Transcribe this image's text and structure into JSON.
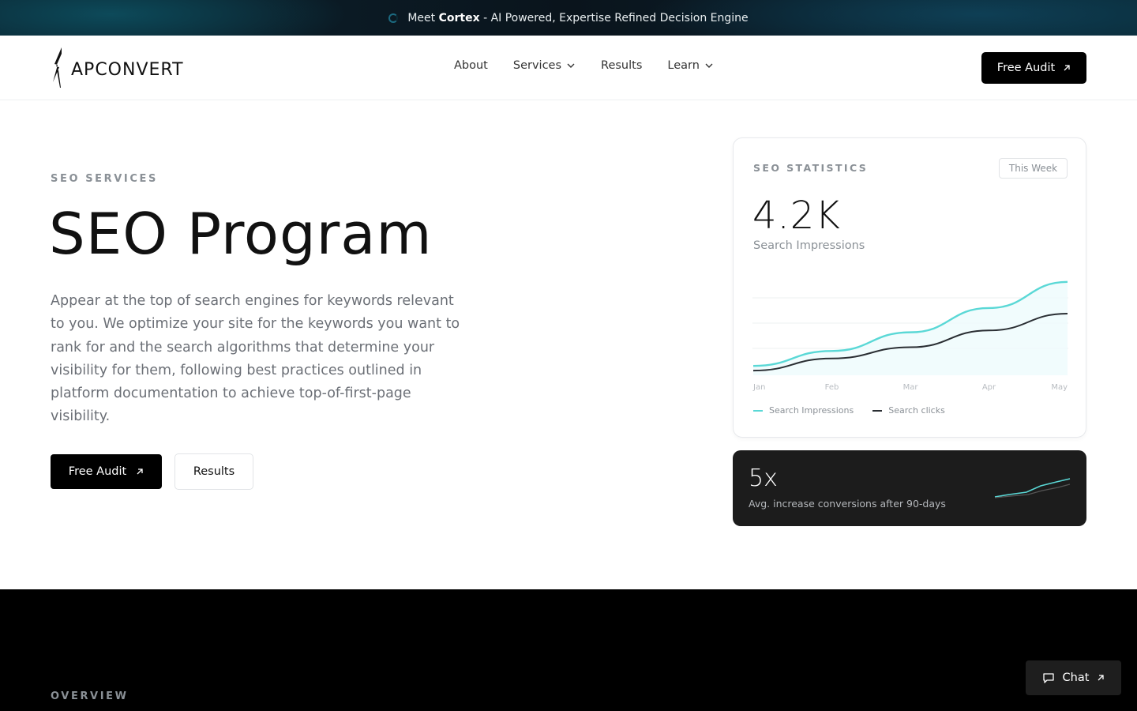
{
  "announcement": {
    "prefix": "Meet",
    "brand": "Cortex",
    "suffix": "- AI Powered, Expertise Refined Decision Engine"
  },
  "logo": {
    "text": "APCONVERT"
  },
  "nav": {
    "items": [
      {
        "label": "About",
        "has_dropdown": false
      },
      {
        "label": "Services",
        "has_dropdown": true
      },
      {
        "label": "Results",
        "has_dropdown": false
      },
      {
        "label": "Learn",
        "has_dropdown": true
      }
    ],
    "cta_label": "Free Audit"
  },
  "hero": {
    "eyebrow": "SEO SERVICES",
    "title": "SEO Program",
    "description": "Appear at the top of search engines for keywords relevant to you. We optimize your site for the keywords you want to rank for and the search algorithms that determine your visibility for them, following best practices outlined in platform documentation to achieve top-of-first-page visibility.",
    "primary_button": "Free Audit",
    "secondary_button": "Results"
  },
  "stats_card": {
    "title": "SEO STATISTICS",
    "period": "This Week",
    "value": "4.2K",
    "value_label": "Search Impressions"
  },
  "chart_data": {
    "type": "line",
    "categories": [
      "Jan",
      "Feb",
      "Mar",
      "Apr",
      "May"
    ],
    "series": [
      {
        "name": "Search Impressions",
        "color": "#5ad8d6",
        "values": [
          10,
          26,
          46,
          72,
          100
        ]
      },
      {
        "name": "Search clicks",
        "color": "#2a2e33",
        "values": [
          5,
          18,
          30,
          48,
          66
        ]
      }
    ],
    "ylim": [
      0,
      110
    ],
    "grid": true,
    "legend_position": "bottom-left"
  },
  "highlight": {
    "value": "5x",
    "label": "Avg. increase conversions after 90-days",
    "colors": {
      "accent": "#5ad8d6",
      "secondary": "#555555"
    }
  },
  "overview": {
    "label": "OVERVIEW"
  },
  "chat": {
    "label": "Chat"
  },
  "colors": {
    "accent": "#5ad8d6",
    "dark": "#000000",
    "muted": "#8a9096"
  }
}
